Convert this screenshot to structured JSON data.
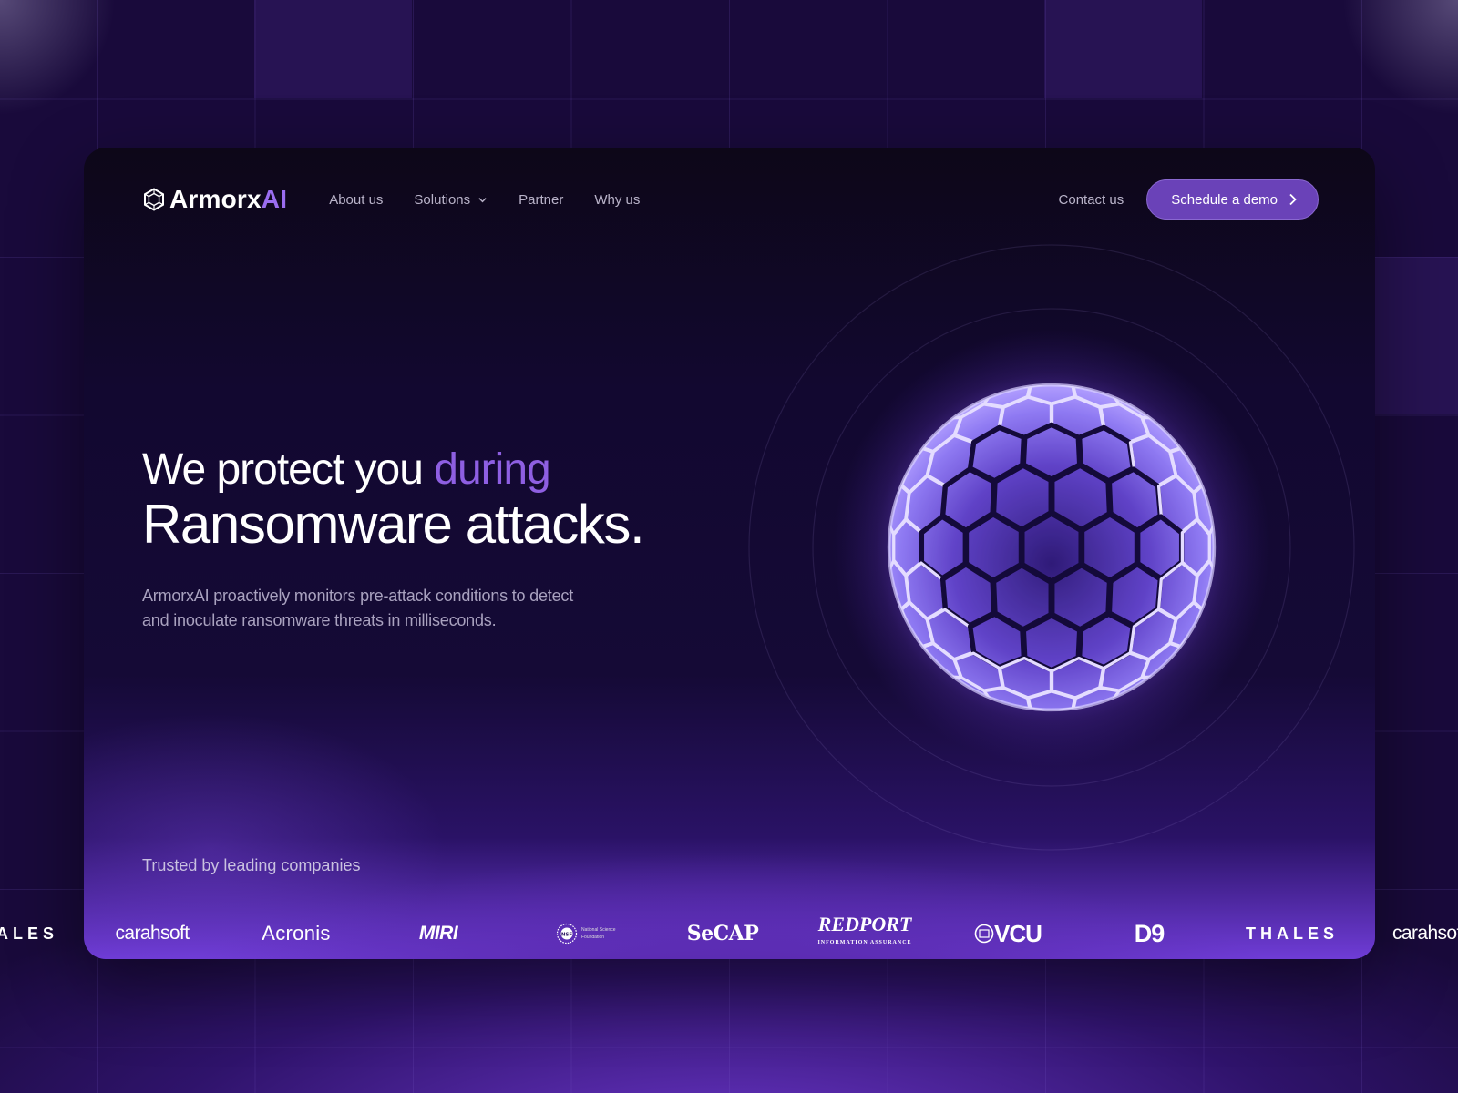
{
  "brand": {
    "name": "Armorx",
    "suffix": "AI"
  },
  "nav": {
    "links": [
      {
        "label": "About us"
      },
      {
        "label": "Solutions"
      },
      {
        "label": "Partner"
      },
      {
        "label": "Why us"
      }
    ],
    "contact": "Contact us",
    "cta": "Schedule a demo"
  },
  "hero": {
    "line1": "We protect you",
    "line1_accent": "during",
    "line2": "Ransomware attacks.",
    "subtitle": "ArmorxAI proactively monitors pre-attack conditions to detect and inoculate ransomware threats in milliseconds."
  },
  "trusted": {
    "label": "Trusted by leading companies",
    "logos": [
      "ALES",
      "carahsoft",
      "Acronis",
      "MIRI",
      "National Science Foundation",
      "SeCAP",
      "REDPORT",
      "INFORMATION ASSURANCE",
      "VCU",
      "D9",
      "THALES",
      "carahsof"
    ]
  },
  "colors": {
    "accent": "#8e5fe2",
    "cta_bg": "#6a42b8",
    "background": "#190a3b"
  }
}
